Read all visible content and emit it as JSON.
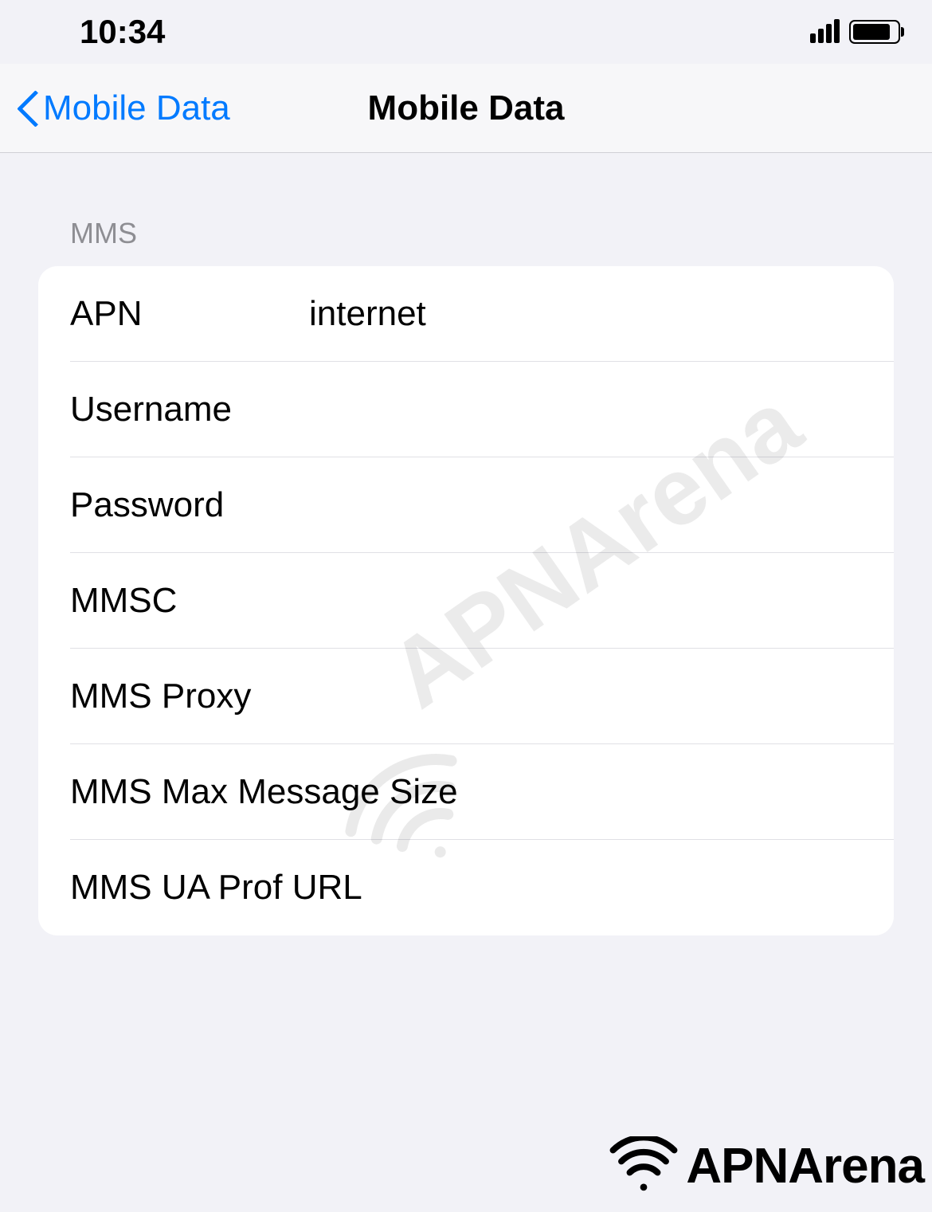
{
  "status_bar": {
    "time": "10:34"
  },
  "nav": {
    "back_label": "Mobile Data",
    "title": "Mobile Data"
  },
  "section": {
    "header": "MMS",
    "rows": [
      {
        "label": "APN",
        "value": "internet"
      },
      {
        "label": "Username",
        "value": ""
      },
      {
        "label": "Password",
        "value": ""
      },
      {
        "label": "MMSC",
        "value": ""
      },
      {
        "label": "MMS Proxy",
        "value": ""
      },
      {
        "label": "MMS Max Message Size",
        "value": ""
      },
      {
        "label": "MMS UA Prof URL",
        "value": ""
      }
    ]
  },
  "watermark": {
    "text": "APNArena"
  },
  "footer": {
    "logo_text": "APNArena"
  }
}
